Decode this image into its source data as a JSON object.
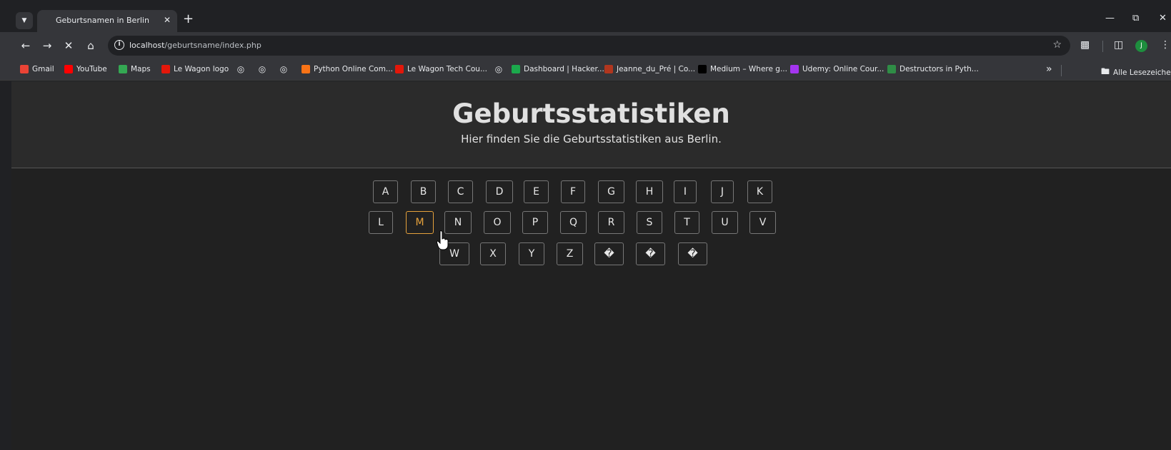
{
  "browser": {
    "tab_title": "Geburtsnamen in Berlin",
    "url_host": "localhost",
    "url_path": "/geburtsname/index.php",
    "avatar_initial": "J",
    "bookmarks": [
      {
        "label": "Gmail",
        "icon": "gmail-icon",
        "color": "#ea4335"
      },
      {
        "label": "YouTube",
        "icon": "youtube-icon",
        "color": "#ff0000"
      },
      {
        "label": "Maps",
        "icon": "maps-icon",
        "color": "#34a853"
      },
      {
        "label": "Le Wagon logo",
        "icon": "lewagon-icon",
        "color": "#e3170a"
      },
      {
        "label": "",
        "icon": "globe-icon",
        "color": "#9aa0a6"
      },
      {
        "label": "",
        "icon": "globe-icon",
        "color": "#9aa0a6"
      },
      {
        "label": "",
        "icon": "globe-icon",
        "color": "#9aa0a6"
      },
      {
        "label": "Python Online Com...",
        "icon": "python-icon",
        "color": "#f97316"
      },
      {
        "label": "Le Wagon Tech Cou...",
        "icon": "lewagon-icon",
        "color": "#e3170a"
      },
      {
        "label": "",
        "icon": "globe-icon",
        "color": "#9aa0a6"
      },
      {
        "label": "Dashboard | Hacker...",
        "icon": "hackerrank-icon",
        "color": "#1ba94c"
      },
      {
        "label": "Jeanne_du_Pré | Co...",
        "icon": "codewars-icon",
        "color": "#b1361e"
      },
      {
        "label": "Medium – Where g...",
        "icon": "medium-icon",
        "color": "#000000"
      },
      {
        "label": "Udemy: Online Cour...",
        "icon": "udemy-icon",
        "color": "#a435f0"
      },
      {
        "label": "Destructors in Pyth...",
        "icon": "gfg-icon",
        "color": "#2f8d46"
      }
    ],
    "all_bookmarks_label": "Alle Lesezeichen"
  },
  "page": {
    "title": "Geburtsstatistiken",
    "subtitle": "Hier finden Sie die Geburtsstatistiken aus Berlin.",
    "active_letter": "M",
    "accent_color": "#e6a23c",
    "letter_rows": [
      [
        "A",
        "B",
        "C",
        "D",
        "E",
        "F",
        "G",
        "H",
        "I",
        "J",
        "K"
      ],
      [
        "L",
        "M",
        "N",
        "O",
        "P",
        "Q",
        "R",
        "S",
        "T",
        "U",
        "V"
      ],
      [
        "W",
        "X",
        "Y",
        "Z",
        "�",
        "�",
        "�"
      ]
    ]
  }
}
